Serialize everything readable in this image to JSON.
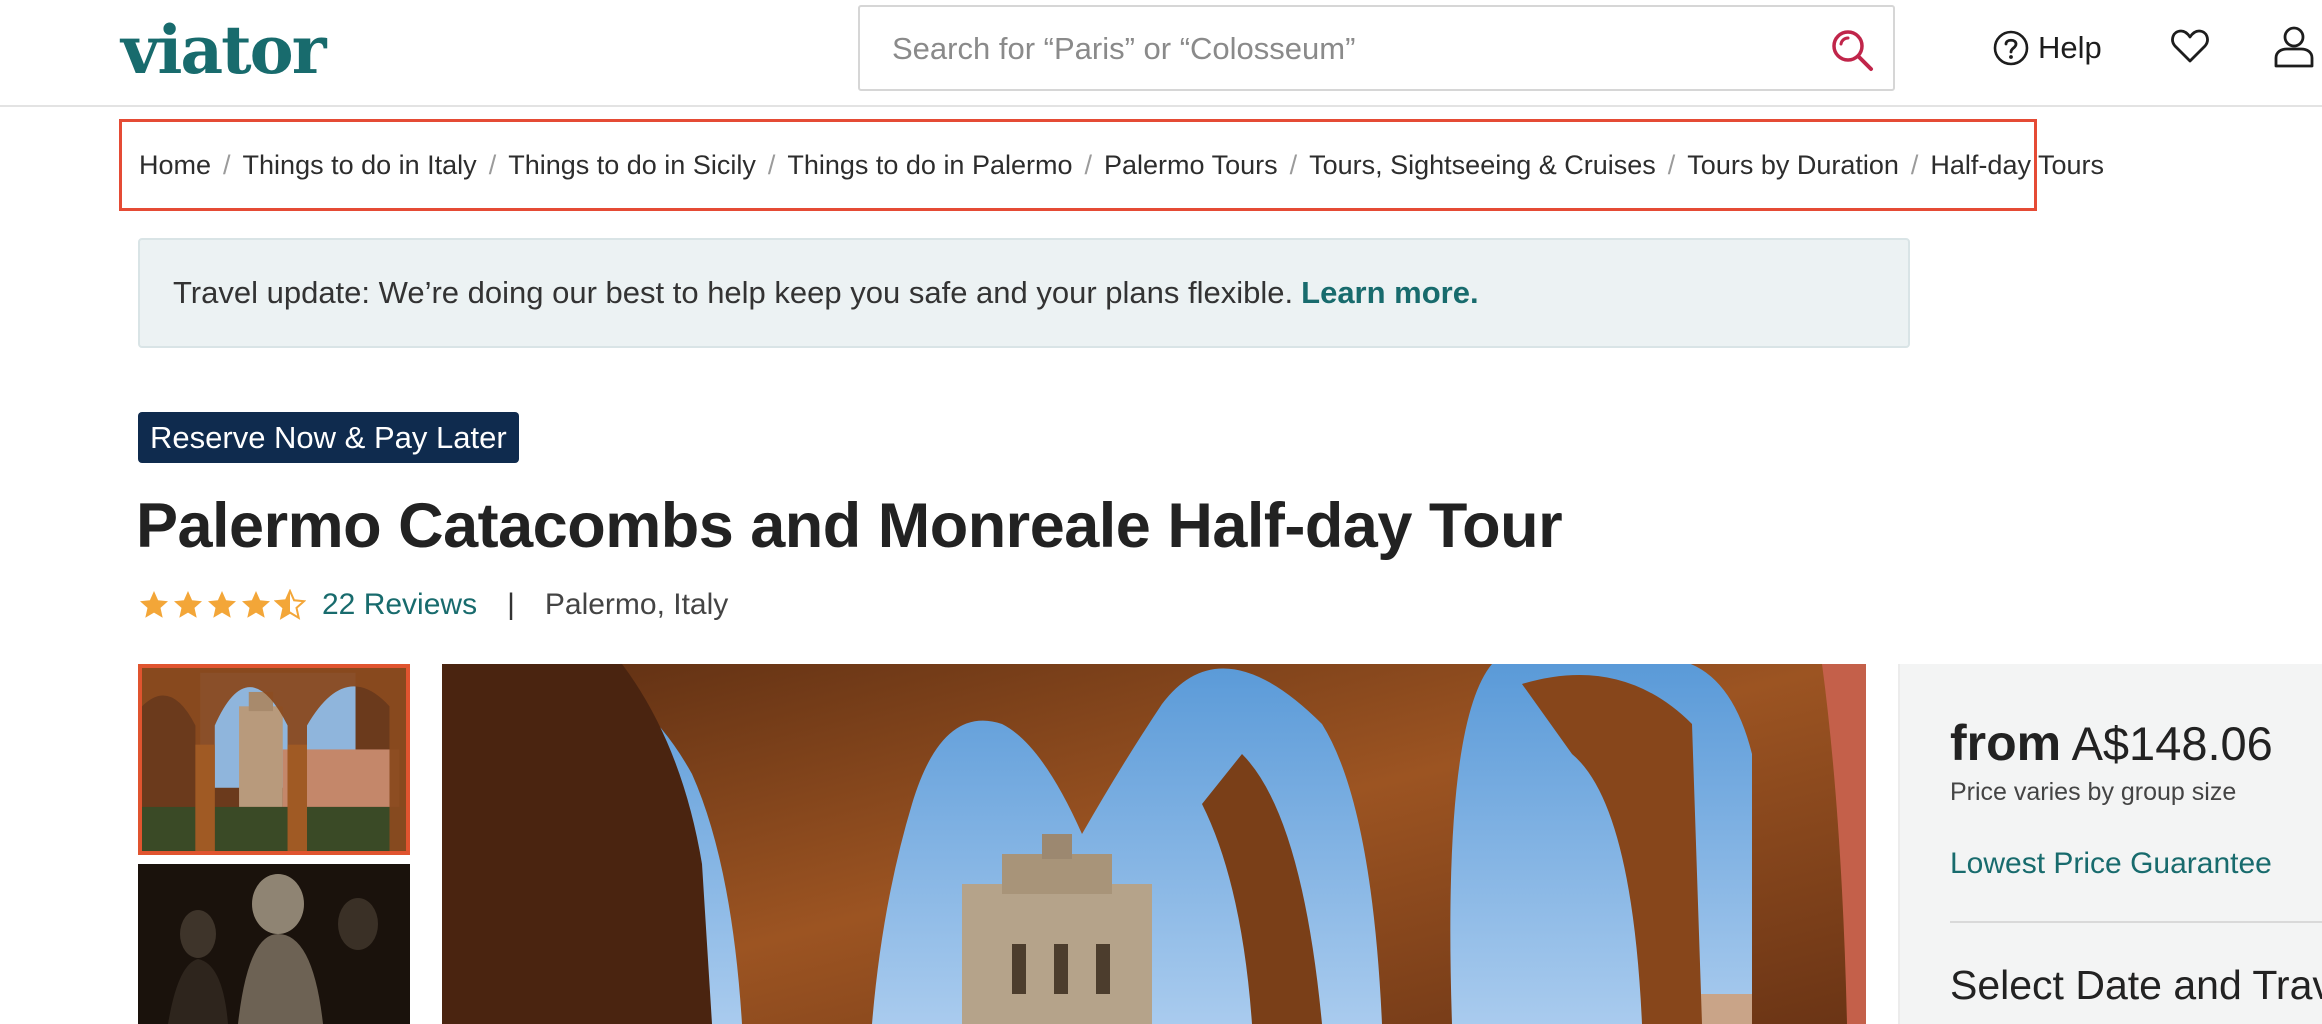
{
  "header": {
    "logo_text": "viator",
    "search_placeholder": "Search for “Paris” or “Colosseum”",
    "help_label": "Help"
  },
  "breadcrumb": [
    "Home",
    "Things to do in Italy",
    "Things to do in Sicily",
    "Things to do in Palermo",
    "Palermo Tours",
    "Tours, Sightseeing & Cruises",
    "Tours by Duration",
    "Half-day Tours"
  ],
  "notice": {
    "text": "Travel update: We’re doing our best to help keep you safe and your plans flexible.",
    "link": "Learn more."
  },
  "badge": "Reserve Now & Pay Later",
  "product": {
    "title": "Palermo Catacombs and Monreale Half-day Tour",
    "rating": 4.5,
    "reviews": "22 Reviews",
    "separator": "|",
    "location": "Palermo, Italy"
  },
  "price": {
    "from_label": "from",
    "amount": "A$148.06",
    "note": "Price varies by group size",
    "guarantee": "Lowest Price Guarantee",
    "select_heading": "Select Date and Travelers"
  },
  "colors": {
    "brand": "#186b6d",
    "badge_bg": "#0f2b4e",
    "highlight_border": "#e54b35",
    "star": "#f3a638",
    "search_icon": "#c0254a"
  }
}
